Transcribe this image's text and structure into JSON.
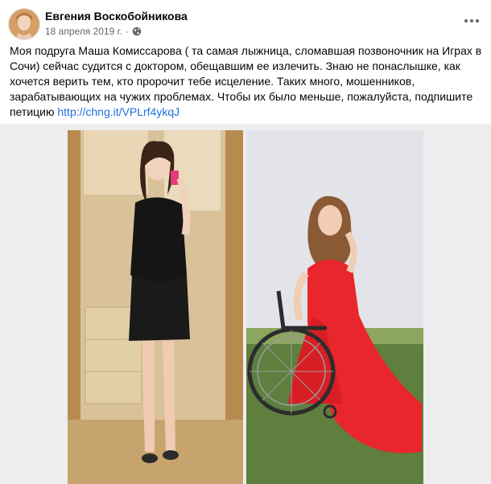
{
  "post": {
    "author": "Евгения Воскобойникова",
    "date": "18 апреля 2019 г.",
    "date_separator": "·",
    "text": "Моя подруга Маша Комиссарова ( та самая лыжница, сломавшая позвоночник на Играх в Сочи) сейчас судится с доктором, обещавшим ее излечить. Знаю не понаслышке, как хочется верить тем, кто пророчит тебе исцеление. Таких много, мошенников, зарабатывающих на чужих проблемах. Чтобы их было меньше, пожалуйста, подпишите петицию",
    "link": "http://chng.it/VPLrf4ykqJ"
  },
  "icons": {
    "privacy": "globe-icon",
    "menu": "more-options-icon"
  },
  "colors": {
    "link": "#216fdb",
    "meta": "#65676b",
    "dress_red": "#e8262c"
  }
}
